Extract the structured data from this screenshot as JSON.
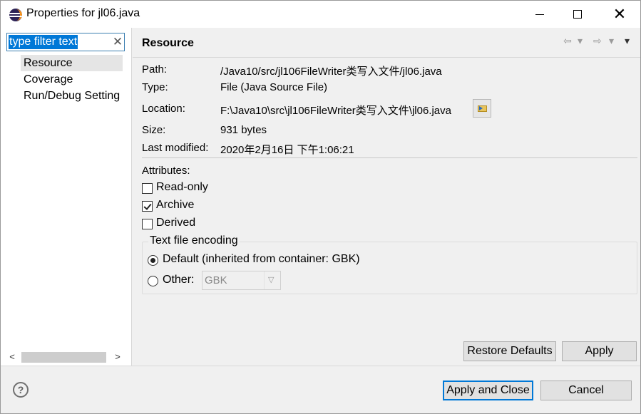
{
  "window": {
    "title": "Properties for jl06.java",
    "close_glyph": "✕"
  },
  "filter": {
    "value": "type filter text",
    "clear_glyph": "✕"
  },
  "tree": {
    "items": [
      {
        "label": "Resource",
        "selected": true
      },
      {
        "label": "Coverage",
        "selected": false
      },
      {
        "label": "Run/Debug Setting",
        "selected": false
      }
    ]
  },
  "scrollbar": {
    "left_glyph": "<",
    "right_glyph": ">"
  },
  "panel": {
    "title": "Resource",
    "nav": {
      "back": "⇦",
      "back_menu": "▾",
      "forward": "⇨",
      "forward_menu": "▾",
      "view_menu": "▾"
    }
  },
  "properties": {
    "path_label": "Path:",
    "path_value": "/Java10/src/jl106FileWriter类写入文件/jl06.java",
    "type_label": "Type:",
    "type_value": "File  (Java Source File)",
    "location_label": "Location:",
    "location_value": "F:\\Java10\\src\\jl106FileWriter类写入文件\\jl06.java",
    "size_label": "Size:",
    "size_value": "931  bytes",
    "modified_label": "Last modified:",
    "modified_value": "2020年2月16日 下午1:06:21"
  },
  "attributes": {
    "heading": "Attributes:",
    "read_only": {
      "label": "Read-only",
      "checked": false
    },
    "archive": {
      "label": "Archive",
      "checked": true
    },
    "derived": {
      "label": "Derived",
      "checked": false
    }
  },
  "encoding": {
    "legend": "Text file encoding",
    "default_label": "Default (inherited from container: GBK)",
    "other_label": "Other:",
    "other_value": "GBK",
    "selected": "default"
  },
  "buttons": {
    "restore_defaults": "Restore Defaults",
    "apply": "Apply",
    "apply_and_close": "Apply and Close",
    "cancel": "Cancel",
    "help": "?"
  }
}
